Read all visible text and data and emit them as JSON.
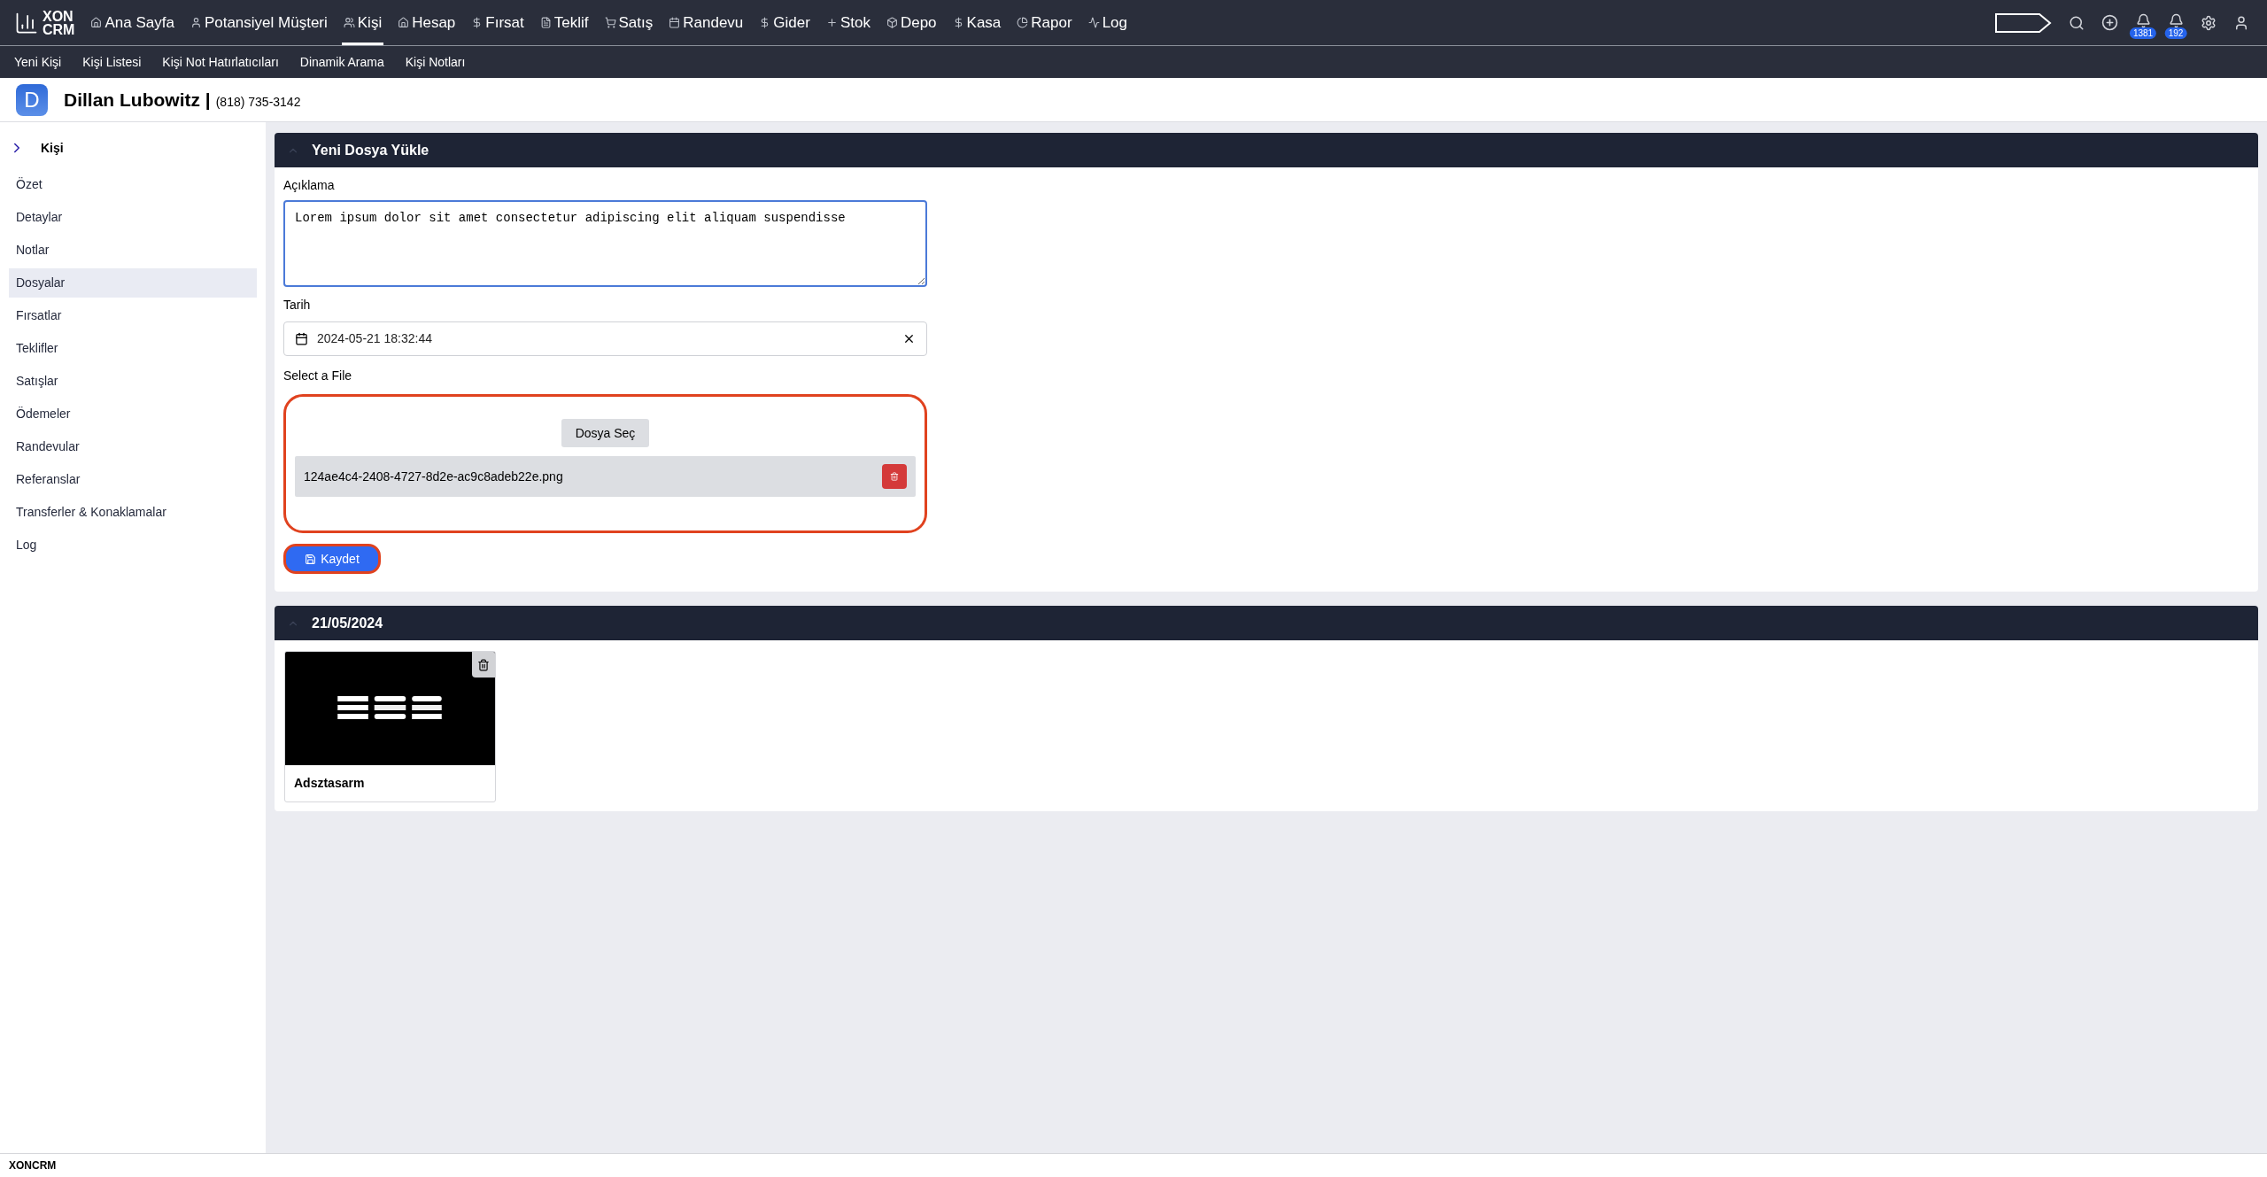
{
  "logo": {
    "line_1": "XON",
    "line_2": "CRM"
  },
  "nav": [
    {
      "label": "Ana Sayfa",
      "selected": false
    },
    {
      "label": "Potansiyel Müşteri",
      "selected": false
    },
    {
      "label": "Kişi",
      "selected": true
    },
    {
      "label": "Hesap",
      "selected": false
    },
    {
      "label": "Fırsat",
      "selected": false
    },
    {
      "label": "Teklif",
      "selected": false
    },
    {
      "label": "Satış",
      "selected": false
    },
    {
      "label": "Randevu",
      "selected": false
    },
    {
      "label": "Gider",
      "selected": false
    },
    {
      "label": "Stok",
      "selected": false
    },
    {
      "label": "Depo",
      "selected": false
    },
    {
      "label": "Kasa",
      "selected": false
    },
    {
      "label": "Rapor",
      "selected": false
    },
    {
      "label": "Log",
      "selected": false
    }
  ],
  "notifications": [
    {
      "count": "1381"
    },
    {
      "count": "192"
    }
  ],
  "subnav": [
    "Yeni Kişi",
    "Kişi Listesi",
    "Kişi Not Hatırlatıcıları",
    "Dinamik Arama",
    "Kişi Notları"
  ],
  "contact": {
    "initial": "D",
    "name": "Dillan Lubowitz |",
    "phone": "(818) 735-3142"
  },
  "sidebar": {
    "title": "Kişi",
    "items": [
      {
        "label": "Özet",
        "selected": false
      },
      {
        "label": "Detaylar",
        "selected": false
      },
      {
        "label": "Notlar",
        "selected": false
      },
      {
        "label": "Dosyalar",
        "selected": true
      },
      {
        "label": "Fırsatlar",
        "selected": false
      },
      {
        "label": "Teklifler",
        "selected": false
      },
      {
        "label": "Satışlar",
        "selected": false
      },
      {
        "label": "Ödemeler",
        "selected": false
      },
      {
        "label": "Randevular",
        "selected": false
      },
      {
        "label": "Referanslar",
        "selected": false
      },
      {
        "label": "Transferler & Konaklamalar",
        "selected": false
      },
      {
        "label": "Log",
        "selected": false
      }
    ]
  },
  "upload_panel": {
    "title": "Yeni Dosya Yükle",
    "description_label": "Açıklama",
    "description_value": "Lorem ipsum dolor sit amet consectetur adipiscing elit aliquam suspendisse",
    "date_label": "Tarih",
    "date_value": "2024-05-21 18:32:44",
    "file_label": "Select a File",
    "choose_button": "Dosya Seç",
    "selected_file": "124ae4c4-2408-4727-8d2e-ac9c8adeb22e.png",
    "save_button": "Kaydet"
  },
  "file_groups": [
    {
      "date": "21/05/2024",
      "files": [
        {
          "kind": "picture",
          "name": "Adsztasarm"
        }
      ]
    }
  ],
  "status_bar": "XONCRM"
}
